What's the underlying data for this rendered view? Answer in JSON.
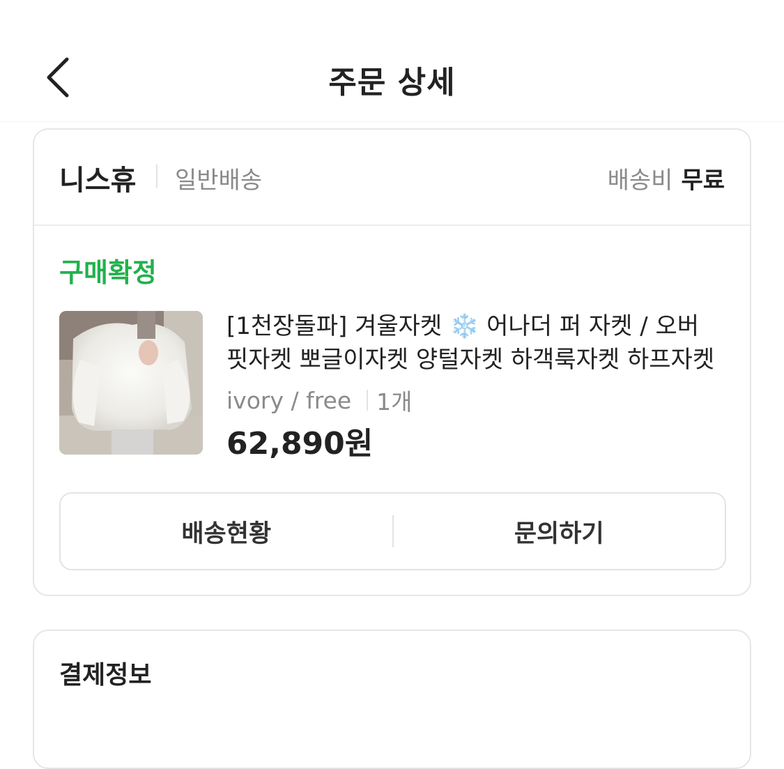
{
  "header": {
    "title": "주문 상세"
  },
  "order": {
    "seller": "니스휴",
    "delivery_type": "일반배송",
    "shipping_fee_label": "배송비",
    "shipping_fee_value": "무료",
    "status": "구매확정",
    "status_color": "#22b14c",
    "product": {
      "name_line1": "[1천장돌파] 겨울자켓 ❄️ 어나더 퍼 자켓 / 오버",
      "name_line2": "핏자켓 뽀글이자켓 양털자켓 하객룩자켓 하프자켓",
      "option": "ivory / free",
      "quantity": "1개",
      "price": "62,890원",
      "image_icon": "product-photo-fur-jacket"
    },
    "actions": {
      "track_label": "배송현황",
      "inquiry_label": "문의하기"
    }
  },
  "next_section": {
    "title": "결제정보"
  }
}
